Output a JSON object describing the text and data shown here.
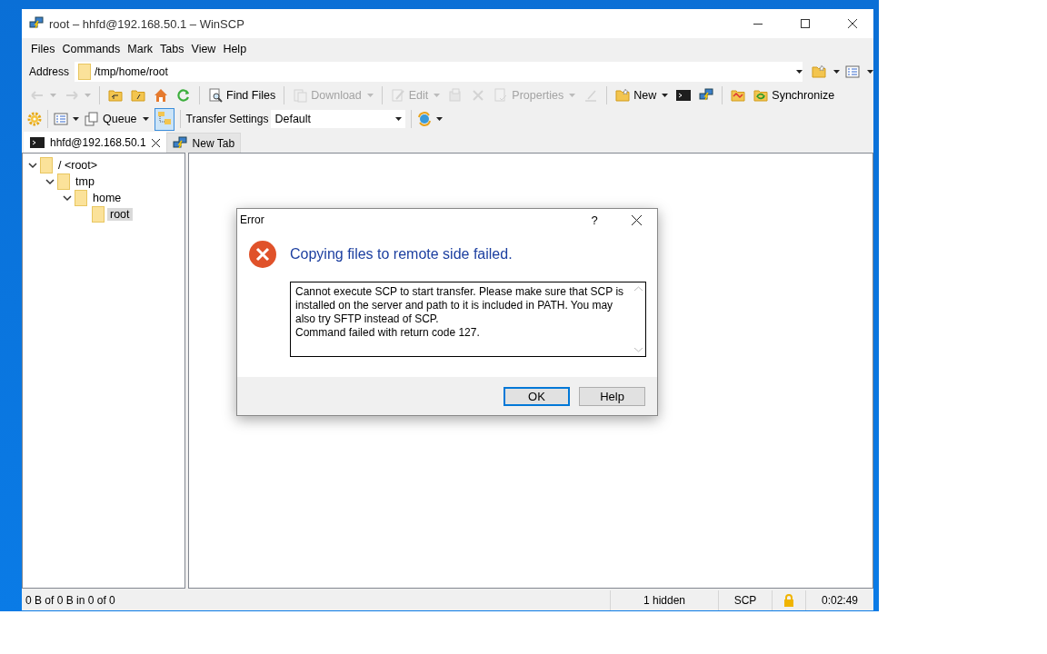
{
  "window": {
    "title": "root – hhfd@192.168.50.1 – WinSCP"
  },
  "menu": [
    "Files",
    "Commands",
    "Mark",
    "Tabs",
    "View",
    "Help"
  ],
  "address": {
    "label": "Address",
    "value": "/tmp/home/root"
  },
  "toolbar": [
    {
      "kind": "back",
      "disabled": true,
      "dropdown": true
    },
    {
      "kind": "forward",
      "disabled": true,
      "dropdown": true
    },
    {
      "kind": "separator"
    },
    {
      "kind": "parent",
      "disabled": false
    },
    {
      "kind": "root",
      "disabled": false
    },
    {
      "kind": "home",
      "disabled": false
    },
    {
      "kind": "refresh",
      "disabled": false
    },
    {
      "kind": "separator"
    },
    {
      "kind": "find",
      "label": "Find Files",
      "disabled": false
    },
    {
      "kind": "separator"
    },
    {
      "kind": "download",
      "label": "Download",
      "disabled": true,
      "dropdown": true
    },
    {
      "kind": "separator"
    },
    {
      "kind": "edit",
      "label": "Edit",
      "disabled": true,
      "dropdown": true
    },
    {
      "kind": "copy",
      "disabled": true
    },
    {
      "kind": "delete",
      "disabled": true
    },
    {
      "kind": "properties",
      "label": "Properties",
      "disabled": true,
      "dropdown": true
    },
    {
      "kind": "rename",
      "disabled": true
    },
    {
      "kind": "separator"
    },
    {
      "kind": "new",
      "label": "New",
      "disabled": false,
      "dropdown": true
    },
    {
      "kind": "terminal",
      "disabled": false
    },
    {
      "kind": "putty",
      "disabled": false
    },
    {
      "kind": "separator"
    },
    {
      "kind": "compare",
      "disabled": false
    },
    {
      "kind": "sync",
      "label": "Synchronize",
      "disabled": false
    }
  ],
  "toolbar2": {
    "queue_label": "Queue",
    "tree_on": true,
    "transfer_label": "Transfer Settings",
    "transfer_value": "Default"
  },
  "tabs": [
    {
      "label": "hhfd@192.168.50.1",
      "selected": true
    },
    {
      "label": "New Tab",
      "selected": false
    }
  ],
  "tree": [
    {
      "label": "/ <root>",
      "expanded": true,
      "selected": false,
      "children": [
        {
          "label": "tmp",
          "expanded": true,
          "selected": false,
          "children": [
            {
              "label": "home",
              "expanded": true,
              "selected": false,
              "children": [
                {
                  "label": "root",
                  "selected": true
                }
              ]
            }
          ]
        }
      ]
    }
  ],
  "dialog": {
    "title": "Error",
    "help_glyph": "?",
    "heading": "Copying files to remote side failed.",
    "message": [
      "Cannot execute SCP to start transfer. Please make sure that SCP is installed on the server and path to it is included in PATH. You may also try SFTP instead of SCP.",
      "Command failed with return code 127."
    ],
    "buttons": [
      {
        "label": "OK",
        "default": true
      },
      {
        "label": "Help",
        "default": false
      }
    ]
  },
  "status_bar": [
    {
      "kind": "text",
      "text": "0 B of 0 B in 0 of 0"
    },
    {
      "kind": "text",
      "text": "1 hidden"
    },
    {
      "kind": "text",
      "text": "SCP"
    },
    {
      "kind": "lock"
    },
    {
      "kind": "text",
      "text": "0:02:49"
    }
  ]
}
